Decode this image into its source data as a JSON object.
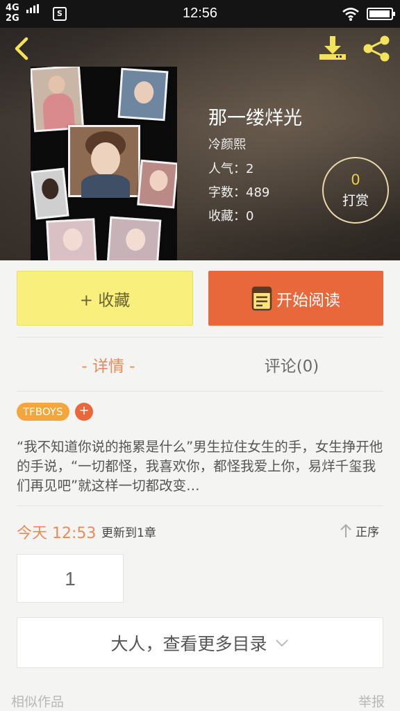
{
  "status_bar": {
    "network_top": "4G",
    "network_bottom": "2G",
    "sim_label": "S",
    "time": "12:56",
    "battery_level": 0.95
  },
  "header": {
    "back_icon": "chevron-left-icon",
    "download_icon": "download-icon",
    "share_icon": "share-icon",
    "accent_color": "#f3e35a"
  },
  "book": {
    "title": "那一缕烊光",
    "author": "冷颜熙",
    "popularity": "人气：2",
    "word_count": "字数：489",
    "favorites": "收藏：0",
    "reward_count": "0",
    "reward_label": "打赏"
  },
  "actions": {
    "collect_label": "+ 收藏",
    "read_label": "开始阅读",
    "collect_color": "#f8ef7c",
    "read_color": "#e8683c"
  },
  "tabs": {
    "details": "- 详情 -",
    "comments": "评论(0)"
  },
  "tags": {
    "items": [
      "TFBOYS"
    ],
    "add_label": "+"
  },
  "synopsis": "“我不知道你说的拖累是什么”男生拉住女生的手，女生挣开他的手说，“一切都怪，我喜欢你，都怪我爱上你，易烊千玺我们再见吧”就这样一切都改变…",
  "updates": {
    "time": "今天 12:53",
    "text": "更新到1章",
    "sort_label": "正序"
  },
  "chapters": [
    "1"
  ],
  "more_toc_label": "大人，查看更多目录",
  "footer": {
    "similar": "相似作品",
    "report": "举报"
  }
}
